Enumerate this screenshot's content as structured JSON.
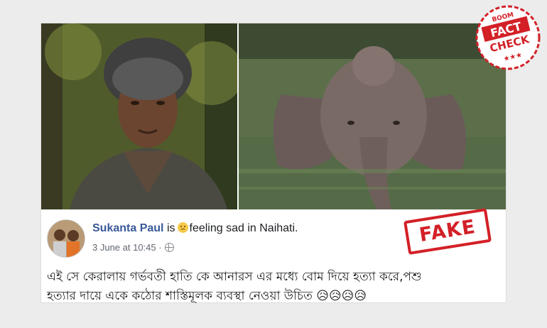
{
  "post": {
    "author": "Sukanta Paul",
    "is_word": "is",
    "feeling_text": "feeling sad in Naihati.",
    "timestamp": "3 June at 10:45 ·",
    "text_line1": "এই সে কেরালায় গর্ভবতী হাতি কে আনারস এর মধ্যে বোম দিয়ে হত্যা করে,পশু",
    "text_line2": "হত্যার দায়ে একে কঠোর শাস্তিমূলক ব্যবস্থা নেওয়া উচিত 😥😥😥😥"
  },
  "stamp": {
    "label": "FAKE",
    "color": "#d32027"
  },
  "badge": {
    "top": "BOOM",
    "line1": "FACT",
    "line2": "CHECK",
    "stars": "★★★",
    "color": "#d32027"
  },
  "colors": {
    "author": "#385898",
    "background": "#ececec"
  }
}
